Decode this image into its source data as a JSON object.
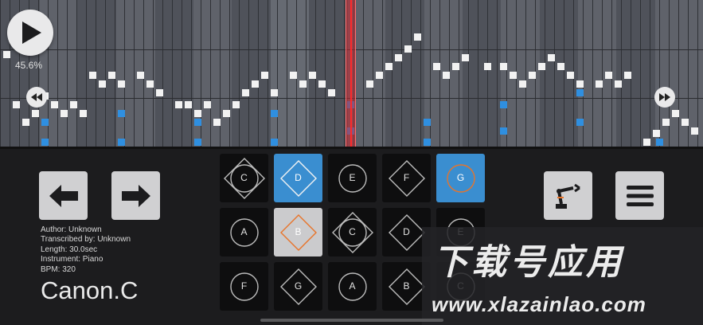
{
  "player": {
    "progress_text": "45.6%",
    "progress_fraction": 0.456,
    "play_icon": "play-icon",
    "rewind_icon": "rewind-icon",
    "fast_forward_icon": "fast-forward-icon"
  },
  "toolbar": {
    "prev_icon": "arrow-left-icon",
    "next_icon": "arrow-right-icon",
    "robot_icon": "robot-arm-icon",
    "menu_icon": "hamburger-menu-icon"
  },
  "song": {
    "author": "Author: Unknown",
    "transcribed_by": "Transcribed by: Unknown",
    "length": "Length: 30.0sec",
    "instrument": "Instrument: Piano",
    "bpm": "BPM: 320",
    "title": "Canon.C"
  },
  "keys": [
    {
      "label": "C",
      "shape": "circle-diamond",
      "state": "normal"
    },
    {
      "label": "D",
      "shape": "diamond",
      "state": "active-blue"
    },
    {
      "label": "E",
      "shape": "circle",
      "state": "normal"
    },
    {
      "label": "F",
      "shape": "diamond",
      "state": "normal"
    },
    {
      "label": "G",
      "shape": "circle",
      "state": "active-blue"
    },
    {
      "label": "A",
      "shape": "circle",
      "state": "normal"
    },
    {
      "label": "B",
      "shape": "diamond",
      "state": "active-grey"
    },
    {
      "label": "C",
      "shape": "circle-diamond",
      "state": "normal"
    },
    {
      "label": "D",
      "shape": "diamond",
      "state": "normal"
    },
    {
      "label": "E",
      "shape": "circle",
      "state": "normal"
    },
    {
      "label": "F",
      "shape": "circle",
      "state": "normal"
    },
    {
      "label": "G",
      "shape": "diamond",
      "state": "normal"
    },
    {
      "label": "A",
      "shape": "circle",
      "state": "normal"
    },
    {
      "label": "B",
      "shape": "diamond",
      "state": "normal"
    },
    {
      "label": "C",
      "shape": "circle",
      "state": "normal"
    }
  ],
  "watermark": {
    "logo_text": "下载号应用",
    "url": "www.xlazainlao.com"
  },
  "colors": {
    "accent_blue": "#3a8ed0",
    "highlight_orange": "#e8742a",
    "playhead_red": "#ff2a2a"
  }
}
